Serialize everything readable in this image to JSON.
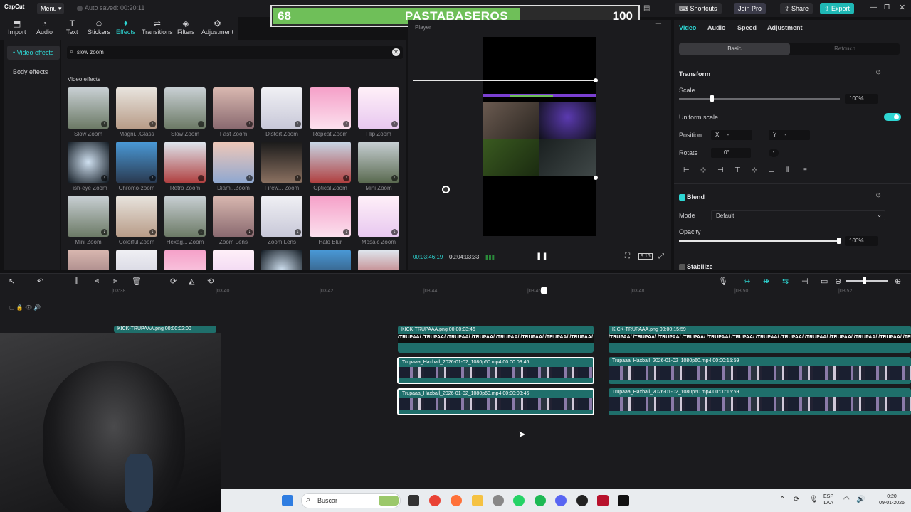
{
  "app": {
    "logo": "CapCut",
    "menu_label": "Menu",
    "autosave": "Auto saved: 00:20:11",
    "shortcuts": "Shortcuts",
    "join_pro": "Join Pro",
    "share": "Share",
    "export": "Export"
  },
  "score_overlay": {
    "left_score": "68",
    "title": "PASTABASEROS",
    "right_score": "100",
    "progress_fraction": 0.68
  },
  "toolbar": {
    "tabs": [
      {
        "label": "Import",
        "icon": "import-icon"
      },
      {
        "label": "Audio",
        "icon": "audio-icon"
      },
      {
        "label": "Text",
        "icon": "text-icon"
      },
      {
        "label": "Stickers",
        "icon": "stickers-icon"
      },
      {
        "label": "Effects",
        "icon": "effects-icon",
        "active": true
      },
      {
        "label": "Transitions",
        "icon": "transitions-icon"
      },
      {
        "label": "Filters",
        "icon": "filters-icon"
      },
      {
        "label": "Adjustment",
        "icon": "adjustment-icon"
      }
    ]
  },
  "sidebar": {
    "items": [
      "• Video effects",
      "Body effects"
    ]
  },
  "effects": {
    "search_value": "slow zoom",
    "section_title": "Video effects",
    "rows": [
      [
        "Slow Zoom",
        "Magni...Glass",
        "Slow Zoom",
        "Fast Zoom",
        "Distort Zoom",
        "Repeat Zoom",
        "Flip Zoom"
      ],
      [
        "Fish-eye Zoom",
        "Chromo-zoom",
        "Retro Zoom",
        "Diam...Zoom",
        "Firew... Zoom",
        "Optical Zoom",
        "Mini Zoom"
      ],
      [
        "Mini Zoom",
        "Colorful Zoom",
        "Hexag... Zoom",
        "Zoom Lens",
        "Zoom Lens",
        "Halo Blur",
        "Mosaic Zoom"
      ]
    ]
  },
  "player": {
    "label": "Player",
    "current_time": "00:03:46:19",
    "total_time": "00:04:03:33",
    "ratio_label": "9:16"
  },
  "inspector": {
    "tabs": [
      "Video",
      "Audio",
      "Speed",
      "Adjustment"
    ],
    "segment_on": "Basic",
    "segment_off": "Retouch",
    "transform_title": "Transform",
    "scale_label": "Scale",
    "scale_value": "100%",
    "uniform_scale_label": "Uniform scale",
    "position_label": "Position",
    "pos_x_label": "X",
    "pos_x_value": "-",
    "pos_y_label": "Y",
    "pos_y_value": "-",
    "rotate_label": "Rotate",
    "rotate_value": "0°",
    "rotate_extra": "-",
    "blend_title": "Blend",
    "mode_label": "Mode",
    "mode_value": "Default",
    "opacity_label": "Opacity",
    "opacity_value": "100%",
    "stabilize_title": "Stabilize"
  },
  "timeline": {
    "ticks": [
      "|03:38",
      "|03:40",
      "|03:42",
      "|03:44",
      "|03:46",
      "|03:48",
      "|03:50",
      "|03:52"
    ],
    "clips": {
      "png_a": "KICK-TRUPAAA.png  00:00:02:00",
      "png_b": "KICK-TRUPAAA.png  00:00:03:46",
      "png_c": "KICK-TRUPAAA.png  00:00:15:59",
      "text_strip": "/TRUPAA/ /TRUPAA/ /TRUPAA/ /TRUPAA/ /TRUPAA/ /TRUPAA/ /TRUPAA/ /TRUPAA/ /TRUPAA/ /TRUPAA/ /TRUPAA/ /TRUPAA/ /TRUPAA/ /TRUPAA/ /TRUPAA/",
      "vid_b": "Trupaaa_Haxball_2026-01-02_1080p60.mp4  00:00:03:46",
      "vid_c": "Trupaaa_Haxball_2026-01-02_1080p60.mp4  00:00:15:59"
    }
  },
  "taskbar": {
    "search_placeholder": "Buscar",
    "lang_top": "ESP",
    "lang_bottom": "LAA",
    "clock_time": "0:20",
    "clock_date": "09-01-2026"
  },
  "colors": {
    "accent": "#2ed6d3",
    "clip_teal": "#1f6f6b",
    "score_green": "#6fbf59"
  }
}
